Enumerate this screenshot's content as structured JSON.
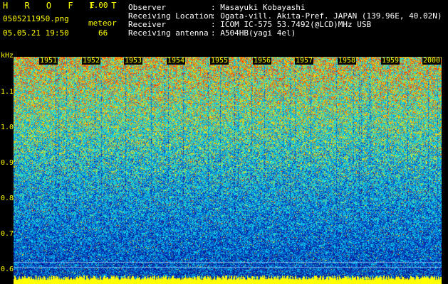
{
  "header": {
    "app_title": "H R O F F T",
    "app_version": "1.00",
    "file_name": "0505211950.png",
    "mode": "meteor",
    "timestamp": "05.05.21 19:50",
    "count": "66"
  },
  "station": [
    {
      "key": "Observer",
      "value": ": Masayuki Kobayashi"
    },
    {
      "key": "Receiving Location",
      "value": ": Ogata-vill. Akita-Pref. JAPAN (139.96E, 40.02N)"
    },
    {
      "key": "Receiver",
      "value": ": ICOM IC-575 53.7492(@LCD)MHz USB"
    },
    {
      "key": "Receiving antenna",
      "value": ": A504HB(yagi 4el)"
    }
  ],
  "spectrogram": {
    "y_axis_unit": "kHz",
    "y_ticks": [
      "1.1",
      "1.0",
      "0.9",
      "0.8",
      "0.7",
      "0.6"
    ],
    "time_ticks": [
      "1951",
      "1952",
      "1953",
      "1954",
      "1955",
      "1956",
      "1957",
      "1958",
      "1959",
      "2000"
    ],
    "colors": {
      "axis_text": "#ffff00",
      "low": "#001a8c",
      "mid": "#00c8ff",
      "high": "#ffff00",
      "peak": "#ff3000"
    }
  }
}
